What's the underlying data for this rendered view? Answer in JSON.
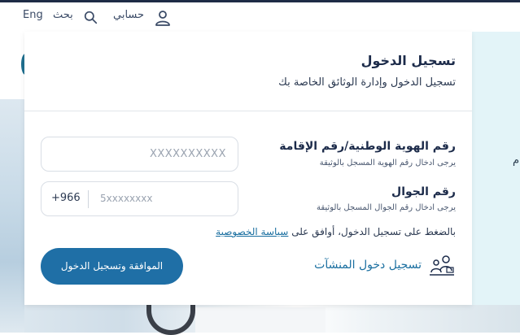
{
  "topbar": {
    "lang": "Eng",
    "search": "بحث",
    "account": "حسابي"
  },
  "panel": {
    "title": "تسجيل الدخول",
    "subtitle": "تسجيل الدخول وإدارة الوثائق الخاصة بك",
    "id_field": {
      "label": "رقم الهوية الوطنية/رقم الإقامة",
      "hint": "يرجى ادخال رقم الهوية المسجل بالوثيقة",
      "placeholder": "XXXXXXXXXX"
    },
    "phone_field": {
      "label": "رقم الجوال",
      "hint": "يرجى ادخال رقم الجوال المسجل بالوثيقة",
      "country_code": "+966",
      "placeholder": "5xxxxxxxx"
    },
    "consent_text": "بالضغط على تسجيل الدخول، أوافق على",
    "privacy_link": "سياسة الخصوصية",
    "facility_login": "تسجيل دخول المنشآت",
    "submit_label": "الموافقة وتسجيل الدخول"
  },
  "background": {
    "right_char": "م"
  },
  "colors": {
    "primary": "#1f6fa6",
    "heading": "#1c2b4a",
    "link": "#1a6fa0",
    "accent_bg": "#e3f4f8"
  }
}
